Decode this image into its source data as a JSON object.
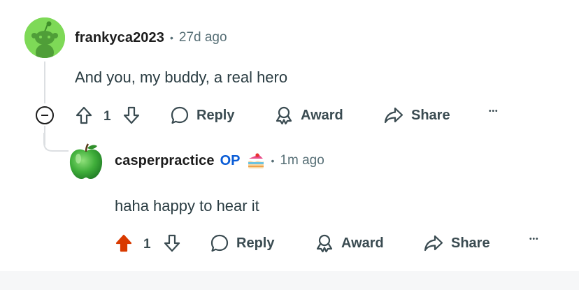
{
  "comments": [
    {
      "username": "frankyca2023",
      "separator": "•",
      "time": "27d ago",
      "body": "And you, my buddy, a real hero",
      "votes": "1",
      "upvoted": false,
      "actions": {
        "reply": "Reply",
        "award": "Award",
        "share": "Share",
        "more": "•••"
      }
    },
    {
      "username": "casperpractice",
      "op_badge": "OP",
      "separator": "•",
      "time": "1m ago",
      "body": "haha happy to hear it",
      "votes": "1",
      "upvoted": true,
      "actions": {
        "reply": "Reply",
        "award": "Award",
        "share": "Share",
        "more": "•••"
      }
    }
  ],
  "icons": {
    "avatar_1": "snoo-avatar-icon",
    "avatar_2": "green-apple-avatar-icon",
    "flair": "cake-flair-icon",
    "upvote": "arrow-up-icon",
    "downvote": "arrow-down-icon",
    "reply": "speech-bubble-icon",
    "award": "award-ribbon-icon",
    "share": "share-arrow-icon",
    "collapse": "minus-circle-icon"
  },
  "colors": {
    "upvote_active": "#d93a00",
    "op_badge": "#0a5cd6",
    "meta_grey": "#576f76",
    "avatar_green": "#7ed957",
    "apple_green": "#3fae3a"
  }
}
